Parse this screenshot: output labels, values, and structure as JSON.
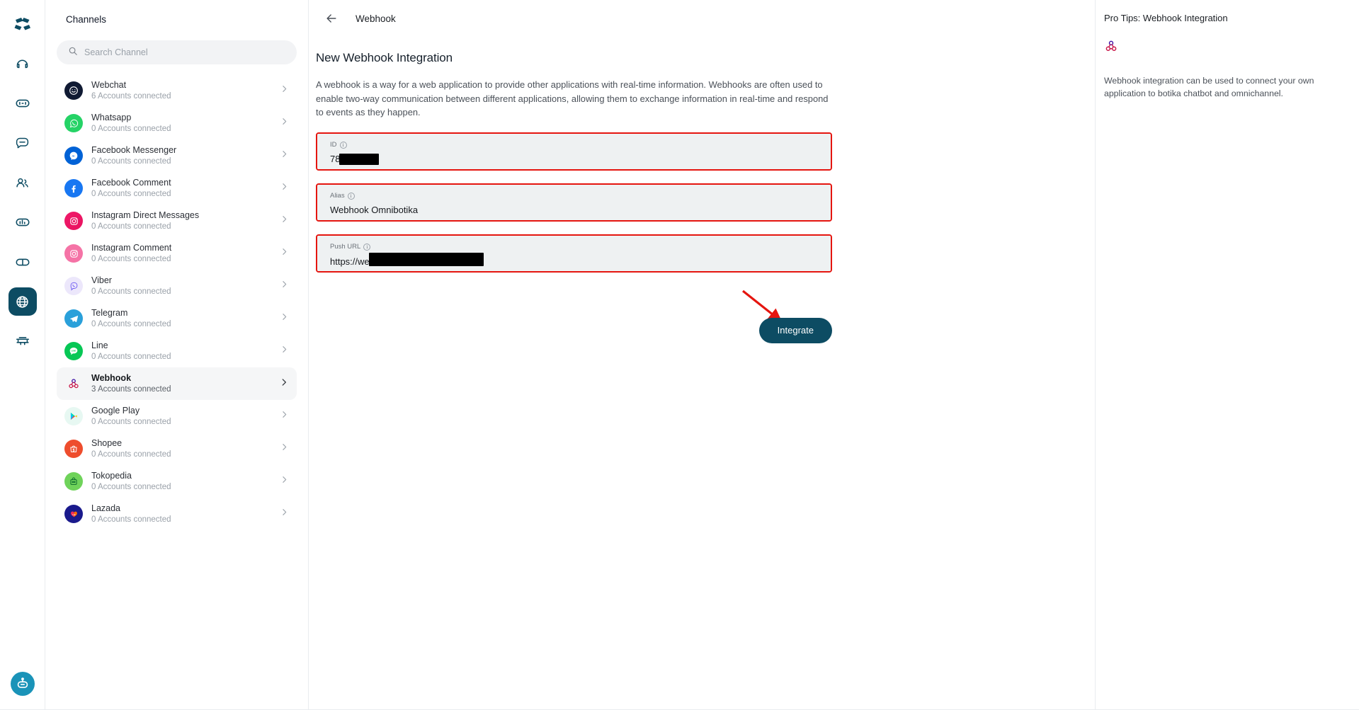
{
  "rail": {
    "logo_icon": "botika-logo-icon",
    "items": [
      {
        "icon": "home-icon",
        "name": "home",
        "active": false
      },
      {
        "icon": "inbox-icon",
        "name": "inbox",
        "active": false
      },
      {
        "icon": "chat-bubble-icon",
        "name": "chat",
        "active": false
      },
      {
        "icon": "contacts-icon",
        "name": "contacts",
        "active": false
      },
      {
        "icon": "analytics-icon",
        "name": "analytics",
        "active": false
      },
      {
        "icon": "broadcast-icon",
        "name": "broadcast",
        "active": false
      },
      {
        "icon": "globe-icon",
        "name": "channels",
        "active": true
      },
      {
        "icon": "integrations-icon",
        "name": "integrations",
        "active": false
      }
    ],
    "bot_icon": "chatbot-avatar-icon"
  },
  "channels": {
    "title": "Channels",
    "search": {
      "placeholder": "Search Channel",
      "value": "",
      "icon": "search-icon"
    },
    "items": [
      {
        "name": "Webchat",
        "accounts": "6 Accounts connected",
        "icon": "webchat-icon",
        "selected": false
      },
      {
        "name": "Whatsapp",
        "accounts": "0 Accounts connected",
        "icon": "whatsapp-icon",
        "selected": false
      },
      {
        "name": "Facebook Messenger",
        "accounts": "0 Accounts connected",
        "icon": "facebook-messenger-icon",
        "selected": false
      },
      {
        "name": "Facebook Comment",
        "accounts": "0 Accounts connected",
        "icon": "facebook-icon",
        "selected": false
      },
      {
        "name": "Instagram Direct Messages",
        "accounts": "0 Accounts connected",
        "icon": "instagram-icon",
        "selected": false
      },
      {
        "name": "Instagram Comment",
        "accounts": "0 Accounts connected",
        "icon": "instagram-comment-icon",
        "selected": false
      },
      {
        "name": "Viber",
        "accounts": "0 Accounts connected",
        "icon": "viber-icon",
        "selected": false
      },
      {
        "name": "Telegram",
        "accounts": "0 Accounts connected",
        "icon": "telegram-icon",
        "selected": false
      },
      {
        "name": "Line",
        "accounts": "0 Accounts connected",
        "icon": "line-icon",
        "selected": false
      },
      {
        "name": "Webhook",
        "accounts": "3 Accounts connected",
        "icon": "webhook-icon",
        "selected": true
      },
      {
        "name": "Google Play",
        "accounts": "0 Accounts connected",
        "icon": "google-play-icon",
        "selected": false
      },
      {
        "name": "Shopee",
        "accounts": "0 Accounts connected",
        "icon": "shopee-icon",
        "selected": false
      },
      {
        "name": "Tokopedia",
        "accounts": "0 Accounts connected",
        "icon": "tokopedia-icon",
        "selected": false
      },
      {
        "name": "Lazada",
        "accounts": "0 Accounts connected",
        "icon": "lazada-icon",
        "selected": false
      }
    ],
    "chevron_icon": "chevron-right-icon"
  },
  "main": {
    "back_icon": "arrow-left-icon",
    "header_title": "Webhook",
    "page_title": "New Webhook Integration",
    "description": "A webhook is a way for a web application to provide other applications with real-time information. Webhooks are often used to enable two-way communication between different applications, allowing them to exchange information in real-time and respond to events as they happen.",
    "fields": [
      {
        "label": "ID",
        "value": "78",
        "redacted": true,
        "redact_width": 56,
        "info_icon": "info-icon"
      },
      {
        "label": "Alias",
        "value": "Webhook Omnibotika",
        "redacted": false,
        "redact_width": 0,
        "info_icon": "info-icon"
      },
      {
        "label": "Push URL",
        "value": "https://we",
        "redacted": true,
        "redact_width": 162,
        "info_icon": "info-icon"
      }
    ],
    "integrate_label": "Integrate",
    "annotation_arrow_icon": "red-arrow-annotation-icon"
  },
  "protips": {
    "title": "Pro Tips: Webhook Integration",
    "icon": "webhook-icon",
    "text": "Webhook integration can be used to connect your own application to botika chatbot and omnichannel."
  },
  "colors": {
    "accent": "#0d4c63",
    "annotation_red": "#e5150f",
    "field_bg": "#eef1f2",
    "selected_bg": "#f5f6f7"
  }
}
